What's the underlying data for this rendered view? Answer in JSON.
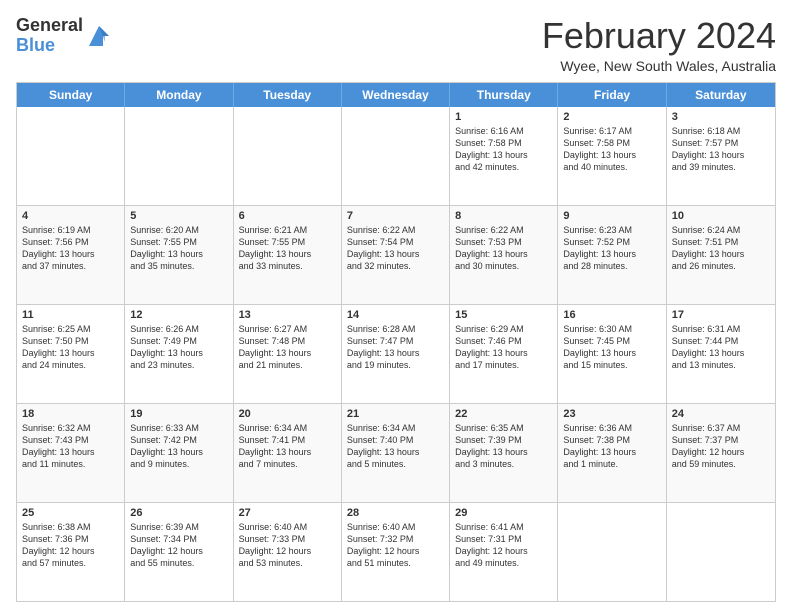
{
  "header": {
    "logo_general": "General",
    "logo_blue": "Blue",
    "main_title": "February 2024",
    "subtitle": "Wyee, New South Wales, Australia"
  },
  "calendar": {
    "days": [
      "Sunday",
      "Monday",
      "Tuesday",
      "Wednesday",
      "Thursday",
      "Friday",
      "Saturday"
    ],
    "rows": [
      [
        {
          "date": "",
          "info": ""
        },
        {
          "date": "",
          "info": ""
        },
        {
          "date": "",
          "info": ""
        },
        {
          "date": "",
          "info": ""
        },
        {
          "date": "1",
          "info": "Sunrise: 6:16 AM\nSunset: 7:58 PM\nDaylight: 13 hours\nand 42 minutes."
        },
        {
          "date": "2",
          "info": "Sunrise: 6:17 AM\nSunset: 7:58 PM\nDaylight: 13 hours\nand 40 minutes."
        },
        {
          "date": "3",
          "info": "Sunrise: 6:18 AM\nSunset: 7:57 PM\nDaylight: 13 hours\nand 39 minutes."
        }
      ],
      [
        {
          "date": "4",
          "info": "Sunrise: 6:19 AM\nSunset: 7:56 PM\nDaylight: 13 hours\nand 37 minutes."
        },
        {
          "date": "5",
          "info": "Sunrise: 6:20 AM\nSunset: 7:55 PM\nDaylight: 13 hours\nand 35 minutes."
        },
        {
          "date": "6",
          "info": "Sunrise: 6:21 AM\nSunset: 7:55 PM\nDaylight: 13 hours\nand 33 minutes."
        },
        {
          "date": "7",
          "info": "Sunrise: 6:22 AM\nSunset: 7:54 PM\nDaylight: 13 hours\nand 32 minutes."
        },
        {
          "date": "8",
          "info": "Sunrise: 6:22 AM\nSunset: 7:53 PM\nDaylight: 13 hours\nand 30 minutes."
        },
        {
          "date": "9",
          "info": "Sunrise: 6:23 AM\nSunset: 7:52 PM\nDaylight: 13 hours\nand 28 minutes."
        },
        {
          "date": "10",
          "info": "Sunrise: 6:24 AM\nSunset: 7:51 PM\nDaylight: 13 hours\nand 26 minutes."
        }
      ],
      [
        {
          "date": "11",
          "info": "Sunrise: 6:25 AM\nSunset: 7:50 PM\nDaylight: 13 hours\nand 24 minutes."
        },
        {
          "date": "12",
          "info": "Sunrise: 6:26 AM\nSunset: 7:49 PM\nDaylight: 13 hours\nand 23 minutes."
        },
        {
          "date": "13",
          "info": "Sunrise: 6:27 AM\nSunset: 7:48 PM\nDaylight: 13 hours\nand 21 minutes."
        },
        {
          "date": "14",
          "info": "Sunrise: 6:28 AM\nSunset: 7:47 PM\nDaylight: 13 hours\nand 19 minutes."
        },
        {
          "date": "15",
          "info": "Sunrise: 6:29 AM\nSunset: 7:46 PM\nDaylight: 13 hours\nand 17 minutes."
        },
        {
          "date": "16",
          "info": "Sunrise: 6:30 AM\nSunset: 7:45 PM\nDaylight: 13 hours\nand 15 minutes."
        },
        {
          "date": "17",
          "info": "Sunrise: 6:31 AM\nSunset: 7:44 PM\nDaylight: 13 hours\nand 13 minutes."
        }
      ],
      [
        {
          "date": "18",
          "info": "Sunrise: 6:32 AM\nSunset: 7:43 PM\nDaylight: 13 hours\nand 11 minutes."
        },
        {
          "date": "19",
          "info": "Sunrise: 6:33 AM\nSunset: 7:42 PM\nDaylight: 13 hours\nand 9 minutes."
        },
        {
          "date": "20",
          "info": "Sunrise: 6:34 AM\nSunset: 7:41 PM\nDaylight: 13 hours\nand 7 minutes."
        },
        {
          "date": "21",
          "info": "Sunrise: 6:34 AM\nSunset: 7:40 PM\nDaylight: 13 hours\nand 5 minutes."
        },
        {
          "date": "22",
          "info": "Sunrise: 6:35 AM\nSunset: 7:39 PM\nDaylight: 13 hours\nand 3 minutes."
        },
        {
          "date": "23",
          "info": "Sunrise: 6:36 AM\nSunset: 7:38 PM\nDaylight: 13 hours\nand 1 minute."
        },
        {
          "date": "24",
          "info": "Sunrise: 6:37 AM\nSunset: 7:37 PM\nDaylight: 12 hours\nand 59 minutes."
        }
      ],
      [
        {
          "date": "25",
          "info": "Sunrise: 6:38 AM\nSunset: 7:36 PM\nDaylight: 12 hours\nand 57 minutes."
        },
        {
          "date": "26",
          "info": "Sunrise: 6:39 AM\nSunset: 7:34 PM\nDaylight: 12 hours\nand 55 minutes."
        },
        {
          "date": "27",
          "info": "Sunrise: 6:40 AM\nSunset: 7:33 PM\nDaylight: 12 hours\nand 53 minutes."
        },
        {
          "date": "28",
          "info": "Sunrise: 6:40 AM\nSunset: 7:32 PM\nDaylight: 12 hours\nand 51 minutes."
        },
        {
          "date": "29",
          "info": "Sunrise: 6:41 AM\nSunset: 7:31 PM\nDaylight: 12 hours\nand 49 minutes."
        },
        {
          "date": "",
          "info": ""
        },
        {
          "date": "",
          "info": ""
        }
      ]
    ]
  }
}
